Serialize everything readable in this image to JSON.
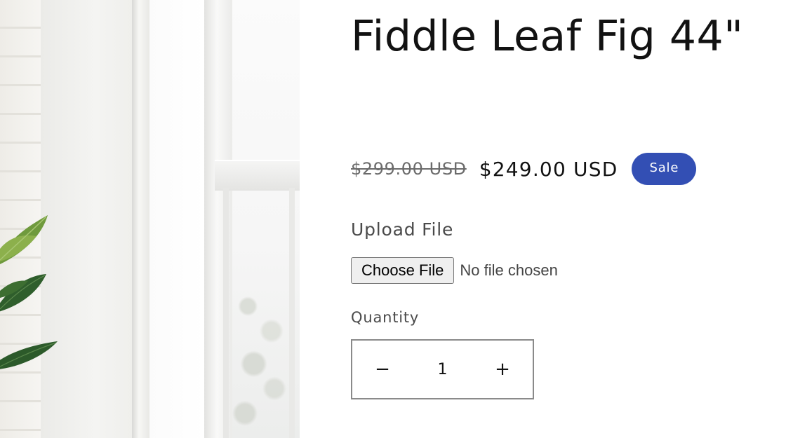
{
  "product": {
    "image_alt": "Fiddle Leaf Fig plant by a window",
    "title": "Fiddle Leaf Fig 44\"",
    "price_regular": "$299.00 USD",
    "price_sale": "$249.00 USD",
    "sale_badge": "Sale"
  },
  "upload": {
    "label": "Upload File",
    "button_label": "Choose File",
    "status_text": "No file chosen"
  },
  "quantity": {
    "label": "Quantity",
    "decrease_symbol": "−",
    "increase_symbol": "+",
    "value": "1"
  },
  "colors": {
    "sale_badge_bg": "#334fb4",
    "text": "#121212",
    "muted_text": "#6b6b6b",
    "stepper_border": "#8a8a8a"
  },
  "icons": {
    "minus": "minus-icon",
    "plus": "plus-icon"
  }
}
